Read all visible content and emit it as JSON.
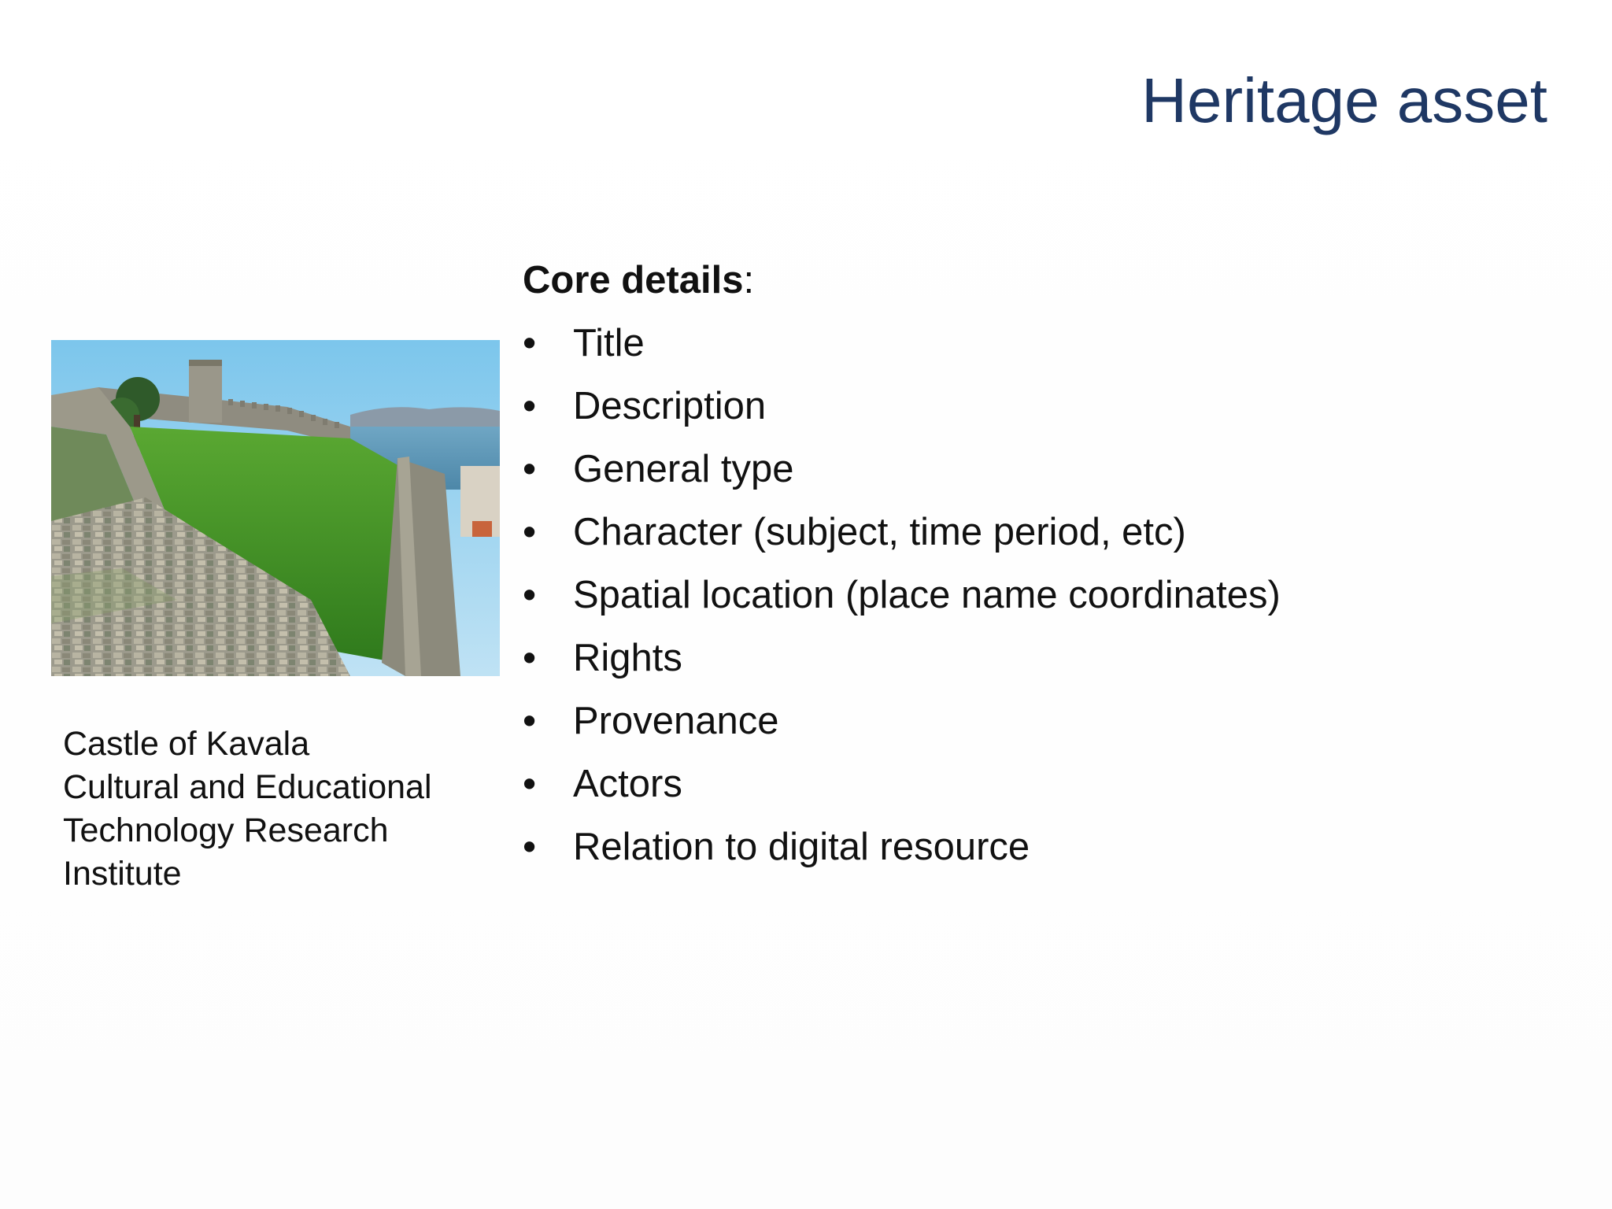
{
  "slide": {
    "title": "Heritage asset",
    "image": {
      "caption_lines": [
        "Castle of Kavala",
        "Cultural and Educational",
        "Technology Research",
        "Institute"
      ]
    },
    "core": {
      "heading": "Core details",
      "heading_suffix": ":",
      "bullet_glyph": "•",
      "items": [
        "Title",
        "Description",
        "General type",
        "Character (subject, time period, etc)",
        "Spatial location (place name coordinates)",
        "Rights",
        "Provenance",
        "Actors",
        "Relation to digital resource"
      ]
    }
  },
  "colors": {
    "title": "#1f3864",
    "text": "#111111",
    "background": "#ffffff"
  }
}
